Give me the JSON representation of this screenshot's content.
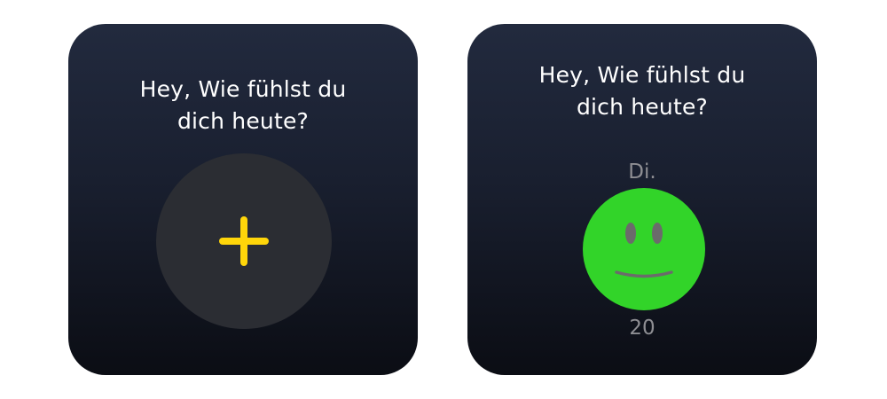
{
  "widgets": [
    {
      "prompt_line1": "Hey, Wie fühlst du",
      "prompt_line2": "dich heute?",
      "add_button_icon": "plus-icon",
      "accent_color": "#ffd60a"
    },
    {
      "prompt_line1": "Hey, Wie fühlst du",
      "prompt_line2": "dich heute?",
      "day": "Di.",
      "date": "20",
      "mood_icon": "smiley-face-icon",
      "mood_color": "#32d429"
    }
  ]
}
